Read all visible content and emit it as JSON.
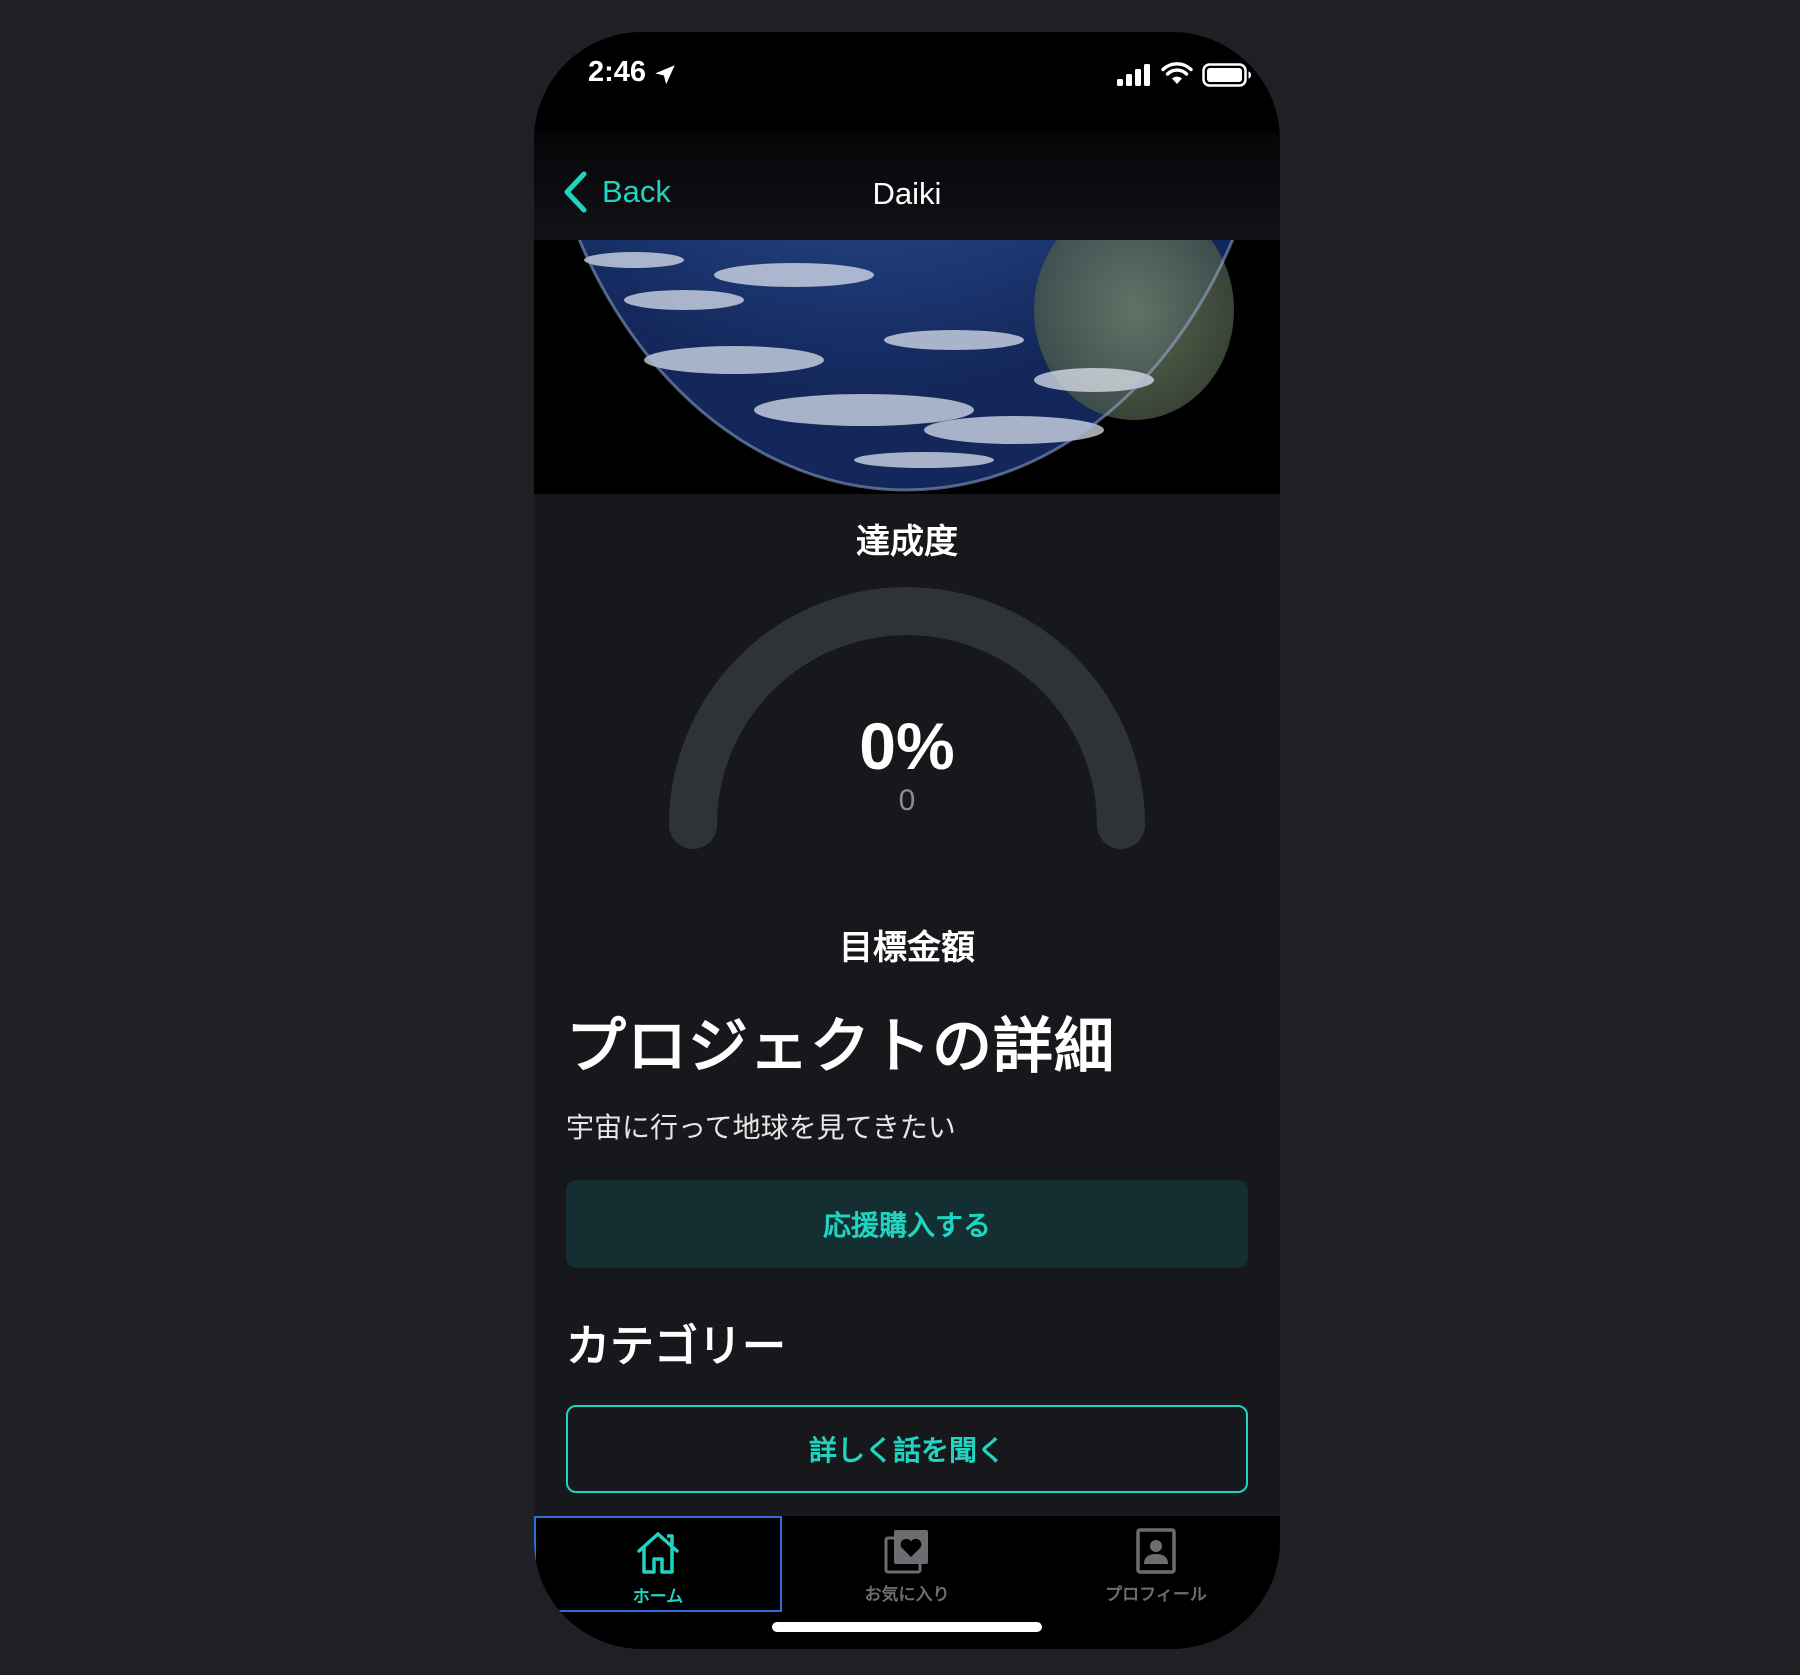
{
  "status_bar": {
    "time": "2:46",
    "icons": [
      "location-arrow-icon",
      "cellular-signal-icon",
      "wifi-icon",
      "battery-icon"
    ]
  },
  "nav": {
    "back_label": "Back",
    "title": "Daiki"
  },
  "hero": {
    "image": "earth-from-space"
  },
  "progress": {
    "label": "達成度",
    "percent_text": "0%",
    "amount_text": "0",
    "percent_value": 0
  },
  "target": {
    "label": "目標金額"
  },
  "project": {
    "heading": "プロジェクトの詳細",
    "description": "宇宙に行って地球を見てきたい",
    "support_button": "応援購入する"
  },
  "category": {
    "heading": "カテゴリー",
    "ask_button": "詳しく話を聞く"
  },
  "tabs": [
    {
      "label": "ホーム",
      "icon": "home-icon",
      "active": true
    },
    {
      "label": "お気に入り",
      "icon": "favorites-heart-icon",
      "active": false
    },
    {
      "label": "プロフィール",
      "icon": "profile-icon",
      "active": false
    }
  ],
  "colors": {
    "accent": "#21d4c1",
    "background": "#16181c",
    "button_fill": "#142f31",
    "gauge_track": "#2f3237"
  }
}
